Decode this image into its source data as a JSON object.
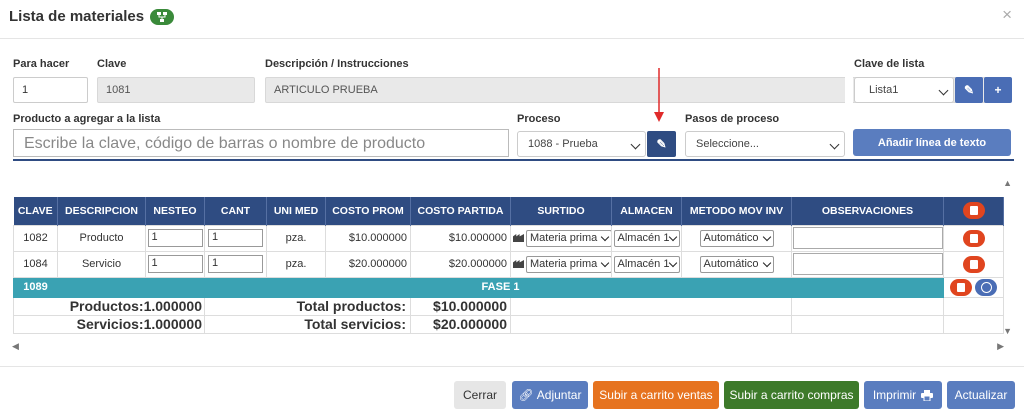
{
  "modal": {
    "title": "Lista de materiales",
    "close": "×"
  },
  "form": {
    "para_hacer": {
      "label": "Para hacer",
      "value": "1"
    },
    "clave": {
      "label": "Clave",
      "value": "1081"
    },
    "descripcion": {
      "label": "Descripción / Instrucciones",
      "value": "ARTICULO PRUEBA"
    },
    "clave_lista": {
      "label": "Clave de lista",
      "value": "Lista1"
    },
    "producto": {
      "label": "Producto a agregar a la lista",
      "placeholder": "Escribe la clave, código de barras o nombre de producto"
    },
    "proceso": {
      "label": "Proceso",
      "value": "1088 - Prueba"
    },
    "pasos": {
      "label": "Pasos de proceso",
      "value": "Seleccione..."
    },
    "add_text_button": "Añadir línea de texto"
  },
  "table": {
    "headers": [
      "CLAVE",
      "DESCRIPCION",
      "NESTEO",
      "CANT",
      "UNI MED",
      "COSTO PROM",
      "COSTO PARTIDA",
      "SURTIDO",
      "ALMACEN",
      "METODO MOV INV",
      "OBSERVACIONES",
      ""
    ],
    "rows": [
      {
        "clave": "1082",
        "descripcion": "Producto",
        "nesteo": "1",
        "cant": "1",
        "uni_med": "pza.",
        "costo_prom": "$10.000000",
        "costo_partida": "$10.000000",
        "surtido": "Materia prima",
        "almacen": "Almacén 1",
        "metodo": "Automático"
      },
      {
        "clave": "1084",
        "descripcion": "Servicio",
        "nesteo": "1",
        "cant": "1",
        "uni_med": "pza.",
        "costo_prom": "$20.000000",
        "costo_partida": "$20.000000",
        "surtido": "Materia prima",
        "almacen": "Almacén 1",
        "metodo": "Automático"
      }
    ],
    "fase": {
      "clave": "1089",
      "label": "FASE 1"
    },
    "totals": [
      {
        "label": "Productos:",
        "count": "1.000000",
        "total_label": "Total productos:",
        "total": "$10.000000"
      },
      {
        "label": "Servicios:",
        "count": "1.000000",
        "total_label": "Total servicios:",
        "total": "$20.000000"
      }
    ]
  },
  "footer": {
    "cerrar": "Cerrar",
    "adjuntar": "Adjuntar",
    "carrito_ventas": "Subir a carrito ventas",
    "carrito_compras": "Subir a carrito compras",
    "imprimir": "Imprimir",
    "actualizar": "Actualizar"
  },
  "colors": {
    "header": "#2f4c82",
    "fase": "#3aa2b3",
    "danger": "#e0451f",
    "orange": "#e6731f",
    "green": "#3d7a2a",
    "blue": "#5a7dbf"
  }
}
